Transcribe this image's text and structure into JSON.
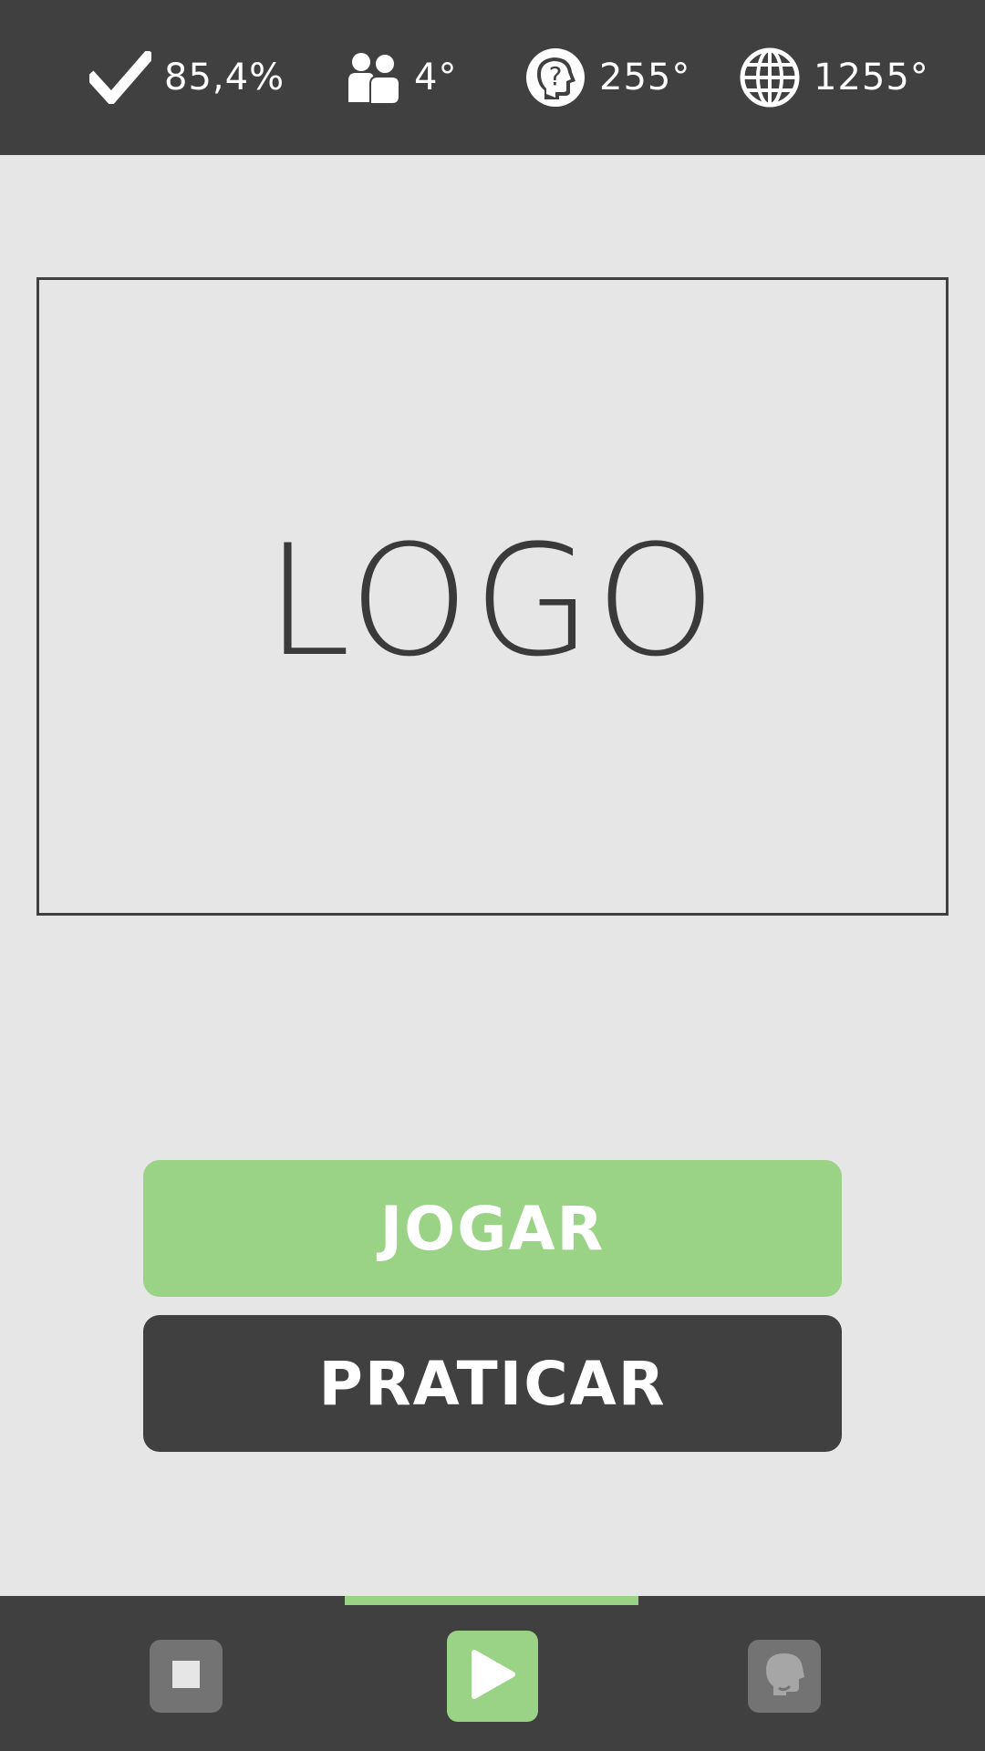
{
  "stats": {
    "accuracy": {
      "icon": "checkmark-icon",
      "value": "85,4%"
    },
    "players": {
      "icon": "users-icon",
      "value": "4°"
    },
    "brain": {
      "icon": "brain-question-icon",
      "value": "255°"
    },
    "global": {
      "icon": "globe-icon",
      "value": "1255°"
    }
  },
  "logo": {
    "text": "LOGO"
  },
  "buttons": {
    "play_label": "JOGAR",
    "practice_label": "PRATICAR"
  },
  "bottom_nav": {
    "items": [
      {
        "icon": "stop-icon",
        "active": false
      },
      {
        "icon": "play-icon",
        "active": true
      },
      {
        "icon": "head-icon",
        "active": false
      }
    ]
  },
  "colors": {
    "bar_bg": "#404040",
    "page_bg": "#e6e6e6",
    "accent_green": "#9bd386",
    "inactive_nav": "#737373"
  }
}
